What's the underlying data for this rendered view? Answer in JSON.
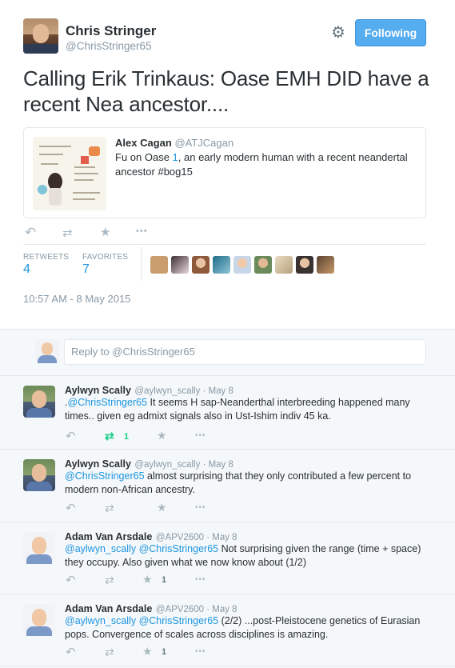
{
  "author": {
    "name": "Chris Stringer",
    "handle": "@ChrisStringer65",
    "follow_label": "Following"
  },
  "tweet": {
    "text_line1": "Calling Erik Trinkaus: Oase EMH DID have a",
    "text_line2": "recent Nea ancestor...."
  },
  "quoted": {
    "name": "Alex Cagan",
    "handle": "@ATJCagan",
    "text_pre": "Fu on Oase ",
    "text_link": "1",
    "text_post": ", an early modern human with a recent neandertal",
    "text_line2": "ancestor #bog15"
  },
  "stats": {
    "retweets_label": "RETWEETS",
    "retweets": "4",
    "favorites_label": "FAVORITES",
    "favorites": "7"
  },
  "timestamp": "10:57 AM - 8 May 2015",
  "reply_placeholder": "Reply to @ChrisStringer65",
  "replies": [
    {
      "name": "Aylwyn Scally",
      "meta": "@aylwyn_scally · May 8",
      "line1_pre": ".",
      "line1_link": "@ChrisStringer65",
      "line1_post": " It seems H sap-Neanderthal interbreeding happened many",
      "line2": "times.. given eg admixt signals also in Ust-Ishim indiv 45 ka.",
      "rt_count": "1",
      "fav_count": ""
    },
    {
      "name": "Aylwyn Scally",
      "meta": "@aylwyn_scally · May 8",
      "line1_pre": "",
      "line1_link": "@ChrisStringer65",
      "line1_post": " almost surprising that they only contributed a few percent to",
      "line2": "modern non-African ancestry.",
      "rt_count": "",
      "fav_count": ""
    },
    {
      "name": "Adam Van Arsdale",
      "meta": "@APV2600 · May 8",
      "line1_pre": "",
      "line1_link": "@aylwyn_scally @ChrisStringer65",
      "line1_post": " Not surprising given the range (time + space)",
      "line2": "they occupy. Also given what we now know about (1/2)",
      "rt_count": "",
      "fav_count": "1"
    },
    {
      "name": "Adam Van Arsdale",
      "meta": "@APV2600 · May 8",
      "line1_pre": "",
      "line1_link": "@aylwyn_scally @ChrisStringer65",
      "line1_post": " (2/2) ...post-Pleistocene genetics of Eurasian",
      "line2": "pops. Convergence of scales across disciplines is amazing.",
      "rt_count": "",
      "fav_count": "1"
    }
  ],
  "icons": {
    "reply": "↶",
    "retweet": "⇄",
    "favorite": "★",
    "more": "•••",
    "gear": "⚙"
  },
  "colors": {
    "accent": "#55acee",
    "link": "#1b95e0",
    "retweet_active": "#19cf86"
  }
}
